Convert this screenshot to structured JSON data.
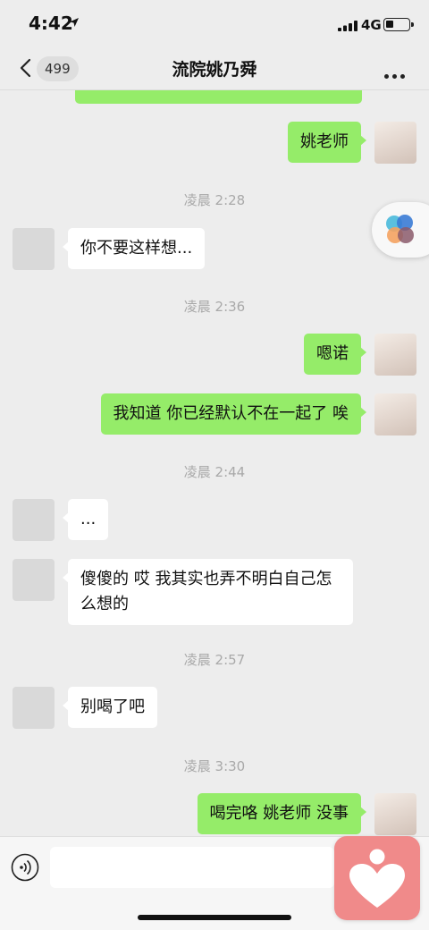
{
  "status_bar": {
    "time": "4:42",
    "network": "4G",
    "battery_level": 0.35
  },
  "header": {
    "back_count": "499",
    "title": "流院姚乃舜"
  },
  "messages": [
    {
      "type": "out",
      "text": "姚老师"
    },
    {
      "type": "time",
      "text": "凌晨 2:28"
    },
    {
      "type": "in",
      "text": "你不要这样想..."
    },
    {
      "type": "time",
      "text": "凌晨 2:36"
    },
    {
      "type": "out",
      "text": "嗯诺"
    },
    {
      "type": "out",
      "text": "我知道 你已经默认不在一起了 唉"
    },
    {
      "type": "time",
      "text": "凌晨 2:44"
    },
    {
      "type": "in",
      "text": "..."
    },
    {
      "type": "in",
      "text": "傻傻的 哎 我其实也弄不明白自己怎么想的"
    },
    {
      "type": "time",
      "text": "凌晨 2:57"
    },
    {
      "type": "in",
      "text": "别喝了吧"
    },
    {
      "type": "time",
      "text": "凌晨 3:30"
    },
    {
      "type": "out",
      "text": "喝完咯 姚老师 没事"
    }
  ],
  "input": {
    "value": ""
  },
  "colors": {
    "outgoing_bubble": "#95ec69",
    "incoming_bubble": "#ffffff",
    "background": "#ededed"
  },
  "icons": [
    "location-arrow-icon",
    "signal-icon",
    "battery-icon",
    "back-chevron-icon",
    "more-icon",
    "voice-icon",
    "floating-app-icon",
    "heart-app-icon"
  ]
}
